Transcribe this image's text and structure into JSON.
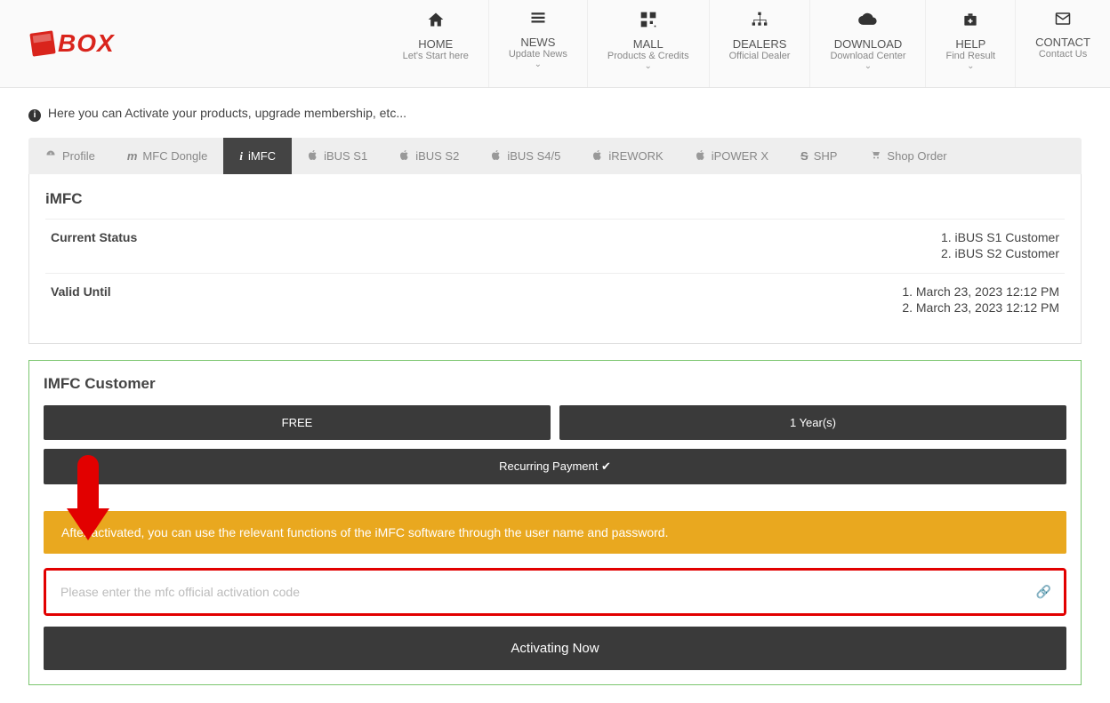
{
  "nav": [
    {
      "title": "HOME",
      "sub": "Let's Start here",
      "chevron": false
    },
    {
      "title": "NEWS",
      "sub": "Update News",
      "chevron": true
    },
    {
      "title": "MALL",
      "sub": "Products & Credits",
      "chevron": true
    },
    {
      "title": "DEALERS",
      "sub": "Official Dealer",
      "chevron": false
    },
    {
      "title": "DOWNLOAD",
      "sub": "Download Center",
      "chevron": true
    },
    {
      "title": "HELP",
      "sub": "Find Result",
      "chevron": true
    },
    {
      "title": "CONTACT",
      "sub": "Contact Us",
      "chevron": false
    }
  ],
  "info_text": "Here you can Activate your products, upgrade membership, etc...",
  "tabs": [
    {
      "label": "Profile",
      "icon": "dashboard"
    },
    {
      "label": "MFC Dongle",
      "icon": "m"
    },
    {
      "label": "iMFC",
      "icon": "info",
      "active": true
    },
    {
      "label": "iBUS S1",
      "icon": "apple"
    },
    {
      "label": "iBUS S2",
      "icon": "apple"
    },
    {
      "label": "iBUS S4/5",
      "icon": "apple"
    },
    {
      "label": "iREWORK",
      "icon": "apple"
    },
    {
      "label": "iPOWER X",
      "icon": "apple"
    },
    {
      "label": "SHP",
      "icon": "s"
    },
    {
      "label": "Shop Order",
      "icon": "cart"
    }
  ],
  "panel": {
    "title": "iMFC",
    "status": {
      "label": "Current Status",
      "values": [
        "1. iBUS S1 Customer",
        "2. iBUS S2 Customer"
      ]
    },
    "valid": {
      "label": "Valid Until",
      "values": [
        "1. March 23, 2023 12:12 PM",
        "2. March 23, 2023 12:12 PM"
      ]
    }
  },
  "customer": {
    "title": "IMFC Customer",
    "free": "FREE",
    "period": "1 Year(s)",
    "recurring": "Recurring Payment",
    "alert": "After activated, you can use the relevant functions of the iMFC software through the user name and password.",
    "placeholder": "Please enter the mfc official activation code",
    "activate": "Activating Now"
  }
}
